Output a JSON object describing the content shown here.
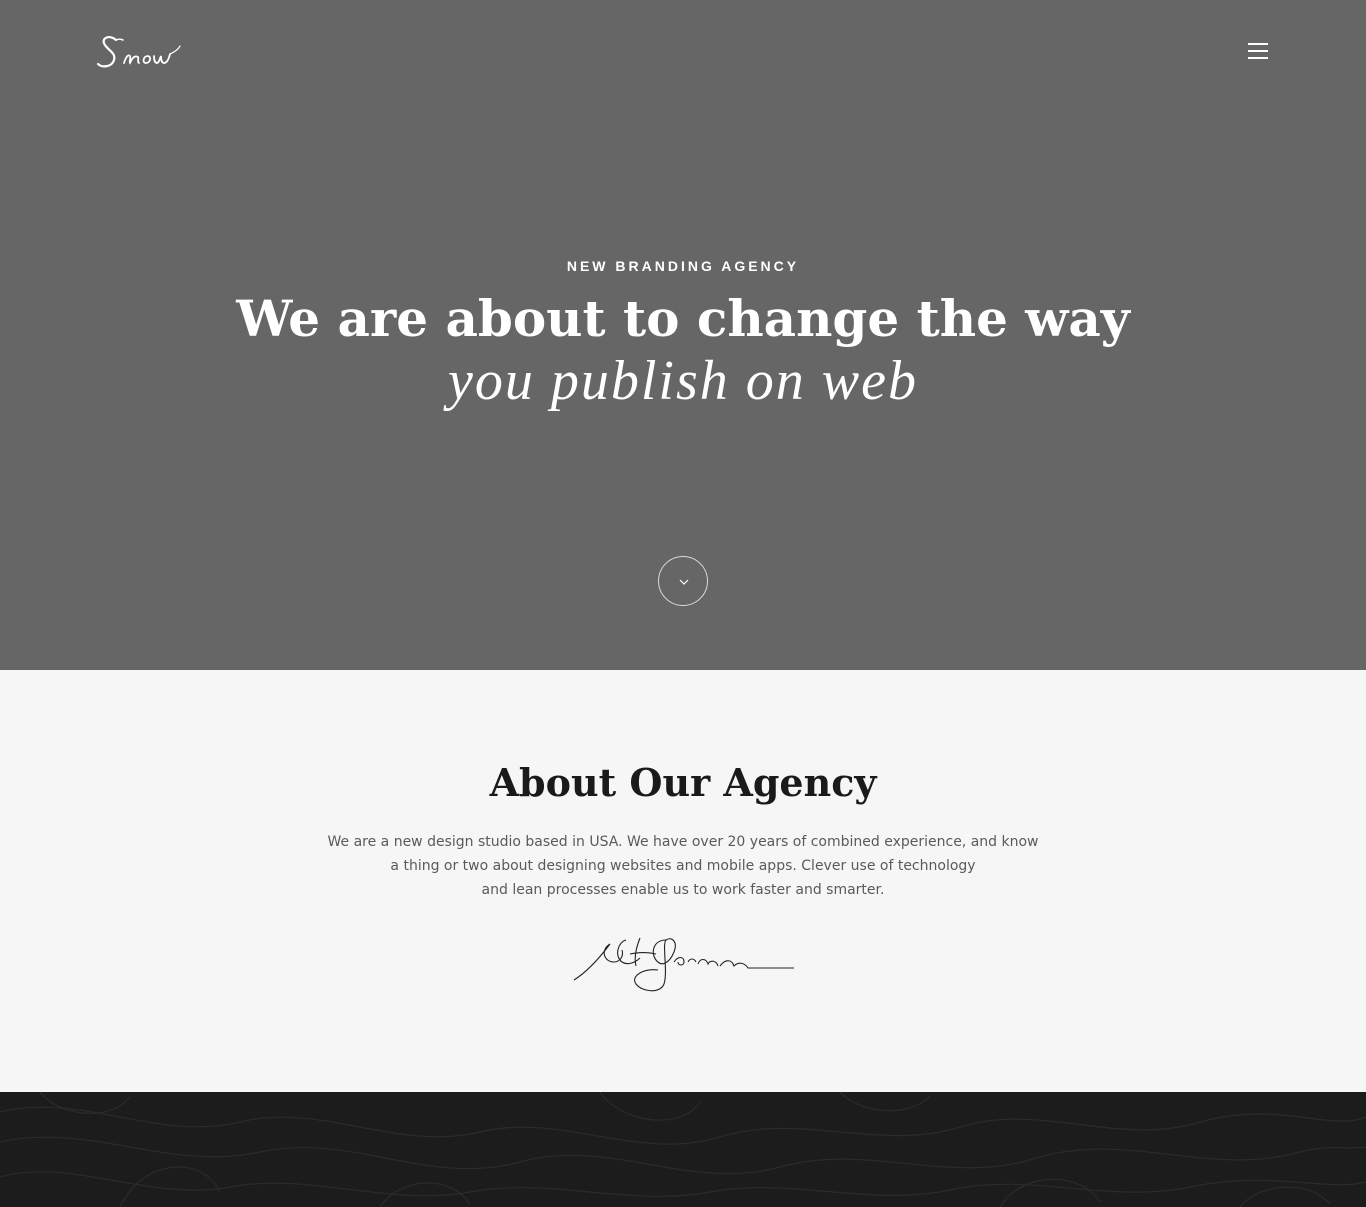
{
  "header": {
    "logo_text": "Snow",
    "menu_icon": "hamburger-icon"
  },
  "hero": {
    "eyebrow": "NEW BRANDING AGENCY",
    "headline_line1": "We are about to change the way",
    "headline_line2": "you publish on web",
    "scroll_icon": "chevron-down-icon"
  },
  "about": {
    "title": "About Our Agency",
    "body_lines": [
      "We are a new design studio based in USA. We have over 20 years of combined experience, and know",
      "a thing or two about designing websites and mobile apps. Clever use of technology",
      "and lean processes enable us to work faster and smarter."
    ]
  },
  "colors": {
    "hero_bg": "#666666",
    "about_bg": "#f6f6f6",
    "dark_bg": "#1c1c1c",
    "text_light": "#ffffff",
    "text_dark": "#1a1a1a",
    "text_body": "#5a5a5a"
  }
}
